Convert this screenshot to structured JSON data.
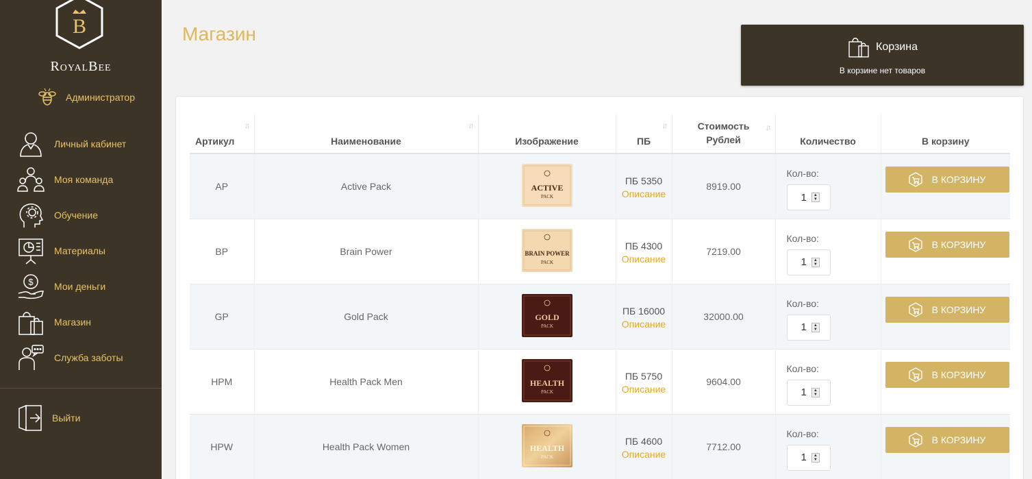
{
  "sidebar": {
    "brand": "RoyalBee",
    "logo_letter": "B",
    "admin_label": "Администратор",
    "items": [
      {
        "label": "Личный кабинет",
        "icon": "user-icon"
      },
      {
        "label": "Моя команда",
        "icon": "team-icon"
      },
      {
        "label": "Обучение",
        "icon": "head-gear-icon"
      },
      {
        "label": "Материалы",
        "icon": "presentation-icon"
      },
      {
        "label": "Мои деньги",
        "icon": "money-hand-icon"
      },
      {
        "label": "Магазин",
        "icon": "shopping-bags-icon"
      },
      {
        "label": "Служба заботы",
        "icon": "support-chat-icon"
      }
    ],
    "logout_label": "Выйти"
  },
  "header": {
    "title": "Магазин"
  },
  "cart": {
    "title": "Корзина",
    "status": "В корзине нет товаров"
  },
  "table": {
    "headers": {
      "article": "Артикул",
      "name": "Наименование",
      "image": "Изображение",
      "pb": "ПБ",
      "price_line1": "Стоимость",
      "price_line2": "Рублей",
      "qty": "Количество",
      "to_cart": "В корзину"
    },
    "qty_label": "Кол-во:",
    "desc_link": "Описание",
    "button_label": "В КОРЗИНУ",
    "rows": [
      {
        "article": "AP",
        "name": "Active Pack",
        "pb": "ПБ 5350",
        "price": "8919.00",
        "qty": "1",
        "img_text": "ACTIVE",
        "img_sub": "PACK",
        "img_theme": "light"
      },
      {
        "article": "BP",
        "name": "Brain Power",
        "pb": "ПБ 4300",
        "price": "7219.00",
        "qty": "1",
        "img_text": "BRAIN POWER",
        "img_sub": "PACK",
        "img_theme": "light"
      },
      {
        "article": "GP",
        "name": "Gold Pack",
        "pb": "ПБ 16000",
        "price": "32000.00",
        "qty": "1",
        "img_text": "GOLD",
        "img_sub": "PACK",
        "img_theme": "dark"
      },
      {
        "article": "HPM",
        "name": "Health Pack Men",
        "pb": "ПБ 5750",
        "price": "9604.00",
        "qty": "1",
        "img_text": "HEALTH",
        "img_sub": "PACK",
        "img_theme": "dark"
      },
      {
        "article": "HPW",
        "name": "Health Pack Women",
        "pb": "ПБ 4600",
        "price": "7712.00",
        "qty": "1",
        "img_text": "HEALTH",
        "img_sub": "PACK",
        "img_theme": "gold"
      }
    ]
  },
  "colors": {
    "sidebar_bg": "#3d3428",
    "accent_gold": "#e8c268",
    "button_gold": "#d3b465",
    "link_orange": "#e6a91e",
    "title_gold": "#e0b85c"
  }
}
